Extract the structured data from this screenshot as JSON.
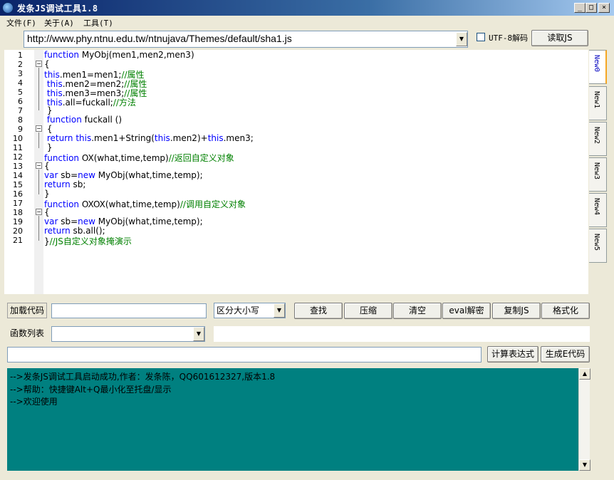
{
  "window": {
    "title": "发条JS调试工具1.8",
    "min_label": "_",
    "max_label": "□",
    "close_label": "×"
  },
  "menu": {
    "items": [
      "文件(F)",
      "关于(A)",
      "工具(T)"
    ]
  },
  "toolbar": {
    "url_value": "http://www.phy.ntnu.edu.tw/ntnujava/Themes/default/sha1.js",
    "utf8_label": "UTF-8解码",
    "utf8_checked": false,
    "load_button": "读取JS"
  },
  "editor": {
    "line_numbers": [
      "1",
      "2",
      "3",
      "4",
      "5",
      "6",
      "7",
      "8",
      "9",
      "10",
      "11",
      "12",
      "13",
      "14",
      "15",
      "16",
      "17",
      "18",
      "19",
      "20",
      "21"
    ],
    "lines": [
      [
        {
          "t": "function ",
          "c": "kw"
        },
        {
          "t": "MyObj(men1,men2,men3)",
          "c": ""
        }
      ],
      [
        {
          "t": "{",
          "c": ""
        }
      ],
      [
        {
          "t": "this",
          "c": "kw"
        },
        {
          "t": ".men1=men1;",
          "c": ""
        },
        {
          "t": "//属性",
          "c": "cm"
        }
      ],
      [
        {
          "t": " this",
          "c": "kw"
        },
        {
          "t": ".men2=men2;",
          "c": ""
        },
        {
          "t": "//属性",
          "c": "cm"
        }
      ],
      [
        {
          "t": " this",
          "c": "kw"
        },
        {
          "t": ".men3=men3;",
          "c": ""
        },
        {
          "t": "//属性",
          "c": "cm"
        }
      ],
      [
        {
          "t": " this",
          "c": "kw"
        },
        {
          "t": ".all=fuckall;",
          "c": ""
        },
        {
          "t": "//方法",
          "c": "cm"
        }
      ],
      [
        {
          "t": " }",
          "c": ""
        }
      ],
      [
        {
          "t": " function ",
          "c": "kw"
        },
        {
          "t": "fuckall ()",
          "c": ""
        }
      ],
      [
        {
          "t": " {",
          "c": ""
        }
      ],
      [
        {
          "t": " return this",
          "c": "kw"
        },
        {
          "t": ".men1+String(",
          "c": ""
        },
        {
          "t": "this",
          "c": "kw"
        },
        {
          "t": ".men2)+",
          "c": ""
        },
        {
          "t": "this",
          "c": "kw"
        },
        {
          "t": ".men3;",
          "c": ""
        }
      ],
      [
        {
          "t": " }",
          "c": ""
        }
      ],
      [
        {
          "t": "function ",
          "c": "kw"
        },
        {
          "t": "OX(what,time,temp)",
          "c": ""
        },
        {
          "t": "//返回自定义对象",
          "c": "cm"
        }
      ],
      [
        {
          "t": "{",
          "c": ""
        }
      ],
      [
        {
          "t": "var ",
          "c": "kw"
        },
        {
          "t": "sb=",
          "c": ""
        },
        {
          "t": "new ",
          "c": "kw"
        },
        {
          "t": "MyObj(what,time,temp);",
          "c": ""
        }
      ],
      [
        {
          "t": "return ",
          "c": "kw"
        },
        {
          "t": "sb;",
          "c": ""
        }
      ],
      [
        {
          "t": "}",
          "c": ""
        }
      ],
      [
        {
          "t": "function ",
          "c": "kw"
        },
        {
          "t": "OXOX(what,time,temp)",
          "c": ""
        },
        {
          "t": "//调用自定义对象",
          "c": "cm"
        }
      ],
      [
        {
          "t": "{",
          "c": ""
        }
      ],
      [
        {
          "t": "var ",
          "c": "kw"
        },
        {
          "t": "sb=",
          "c": ""
        },
        {
          "t": "new ",
          "c": "kw"
        },
        {
          "t": "MyObj(what,time,temp);",
          "c": ""
        }
      ],
      [
        {
          "t": "return ",
          "c": "kw"
        },
        {
          "t": "sb.all();",
          "c": ""
        }
      ],
      [
        {
          "t": "}",
          "c": ""
        },
        {
          "t": "//JS自定义对象掩演示",
          "c": "cm"
        }
      ]
    ],
    "colors": {
      "keyword": "#0000ff",
      "comment": "#008000"
    }
  },
  "tabs": [
    "New0",
    "New1",
    "New2",
    "New3",
    "New4",
    "New5"
  ],
  "tools": {
    "load_code_label": "加载代码",
    "load_code_value": "",
    "case_select": "区分大小写",
    "buttons": [
      "查找",
      "压缩",
      "清空",
      "eval解密",
      "复制JS",
      "格式化"
    ],
    "func_list_label": "函数列表",
    "func_list_value": "",
    "expr_value": "",
    "calc_button": "计算表达式",
    "gen_button": "生成E代码"
  },
  "output": {
    "lines": [
      "-->发条JS调试工具启动成功,作者：发条陈，QQ601612327,版本1.8",
      "-->帮助：快捷键Alt+Q最小化至托盘/显示",
      "-->欢迎使用"
    ],
    "bg_color": "#008080"
  }
}
